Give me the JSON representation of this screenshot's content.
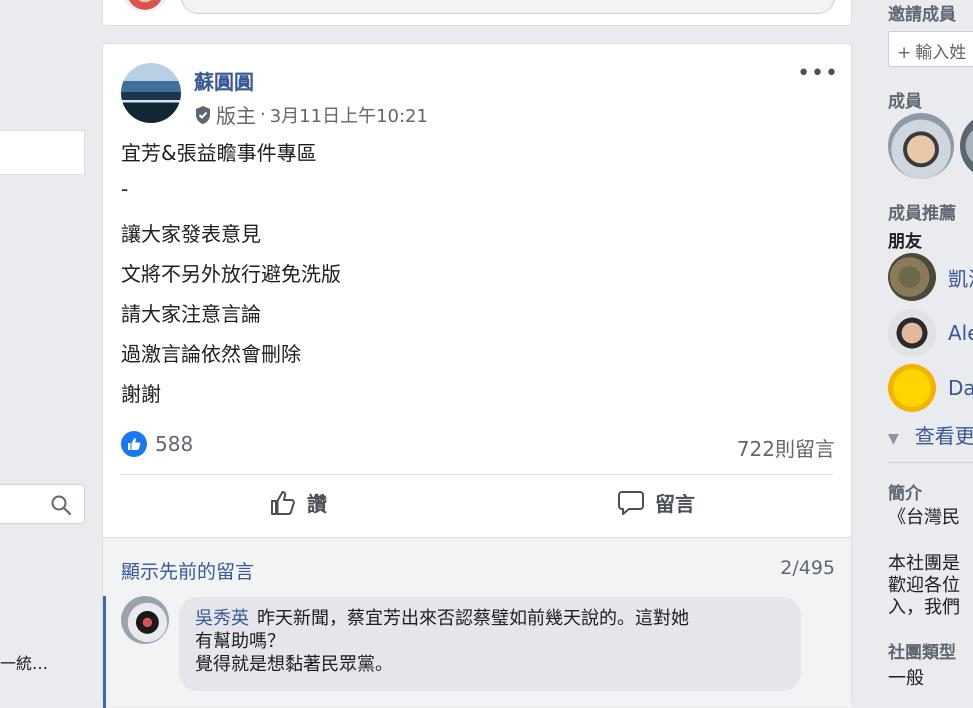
{
  "left": {
    "truncated_text": "一統…"
  },
  "post": {
    "author": "蘇圓圓",
    "role": "版主",
    "separator": "·",
    "timestamp": "3月11日上午10:21",
    "more_label": "•••",
    "lines": [
      "宜芳&張益瞻事件專區",
      "-",
      "讓大家發表意見",
      "文將不另外放行避免洗版",
      "請大家注意言論",
      "過激言論依然會刪除",
      "謝謝"
    ],
    "like_count": "588",
    "comment_count": "722則留言",
    "actions": {
      "like_label": "讚",
      "comment_label": "留言"
    },
    "comments": {
      "show_previous": "顯示先前的留言",
      "pager": "2/495",
      "items": [
        {
          "name": "吳秀英",
          "text_line1": "昨天新聞，蔡宜芳出來否認蔡璧如前幾天說的。這對她",
          "text_line2": "有幫助嗎？",
          "text_line3": "覺得就是想黏著民眾黨。"
        }
      ]
    }
  },
  "sidebar": {
    "invite_heading": "邀請成員",
    "invite_placeholder": "輸入姓",
    "members_heading": "成員",
    "suggest_heading": "成員推薦",
    "friends_heading": "朋友",
    "friends": [
      {
        "name": "凱澄"
      },
      {
        "name": "Ale"
      },
      {
        "name": "Da"
      }
    ],
    "see_more": "查看更",
    "about_heading": "簡介",
    "about_line1": "《台灣民",
    "about_line2": "本社團是",
    "about_line3": "歡迎各位",
    "about_line4": "入，我們",
    "type_heading": "社團類型",
    "type_value": "一般"
  },
  "colors": {
    "link": "#385898",
    "like_blue": "#1877f2",
    "page_bg": "#e9ebee"
  }
}
